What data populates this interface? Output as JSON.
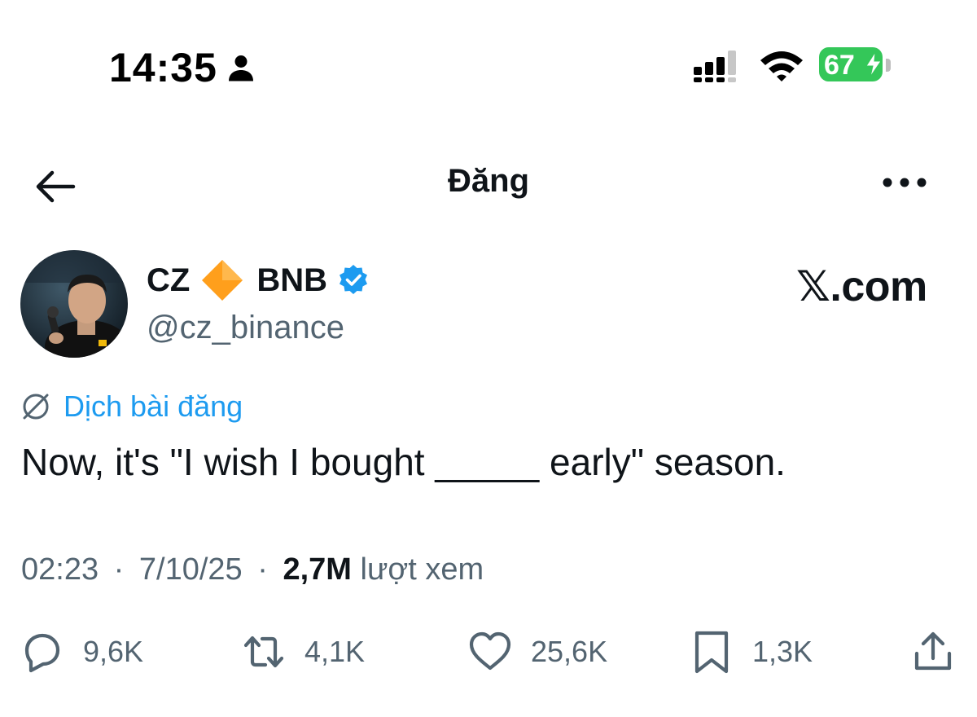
{
  "status_bar": {
    "time": "14:35",
    "battery": "67",
    "icons": [
      "person-icon",
      "signal-icon",
      "wifi-icon",
      "battery-icon",
      "charging-bolt-icon"
    ]
  },
  "nav": {
    "title": "Đăng",
    "back_icon": "arrow-left-icon",
    "more_icon": "more-horizontal-icon"
  },
  "author": {
    "name_first": "CZ",
    "name_last": "BNB",
    "handle": "@cz_binance",
    "badge_icon": "verified-icon",
    "emoji_icon": "orange-diamond-icon"
  },
  "watermark": "𝕏.com",
  "translate_label": "Dịch bài đăng",
  "tweet": {
    "text": "Now, it's \"I wish I bought _____ early\" season."
  },
  "meta": {
    "time": "02:23",
    "separator": "·",
    "date": "7/10/25",
    "views_count": "2,7M",
    "views_label": "lượt xem"
  },
  "actions": {
    "replies": "9,6K",
    "reposts": "4,1K",
    "likes": "25,6K",
    "bookmarks": "1,3K"
  },
  "colors": {
    "text": "#0f1419",
    "secondary": "#536471",
    "link": "#1d9bf0",
    "battery": "#34c759",
    "diamond": "#ff9f1c"
  }
}
